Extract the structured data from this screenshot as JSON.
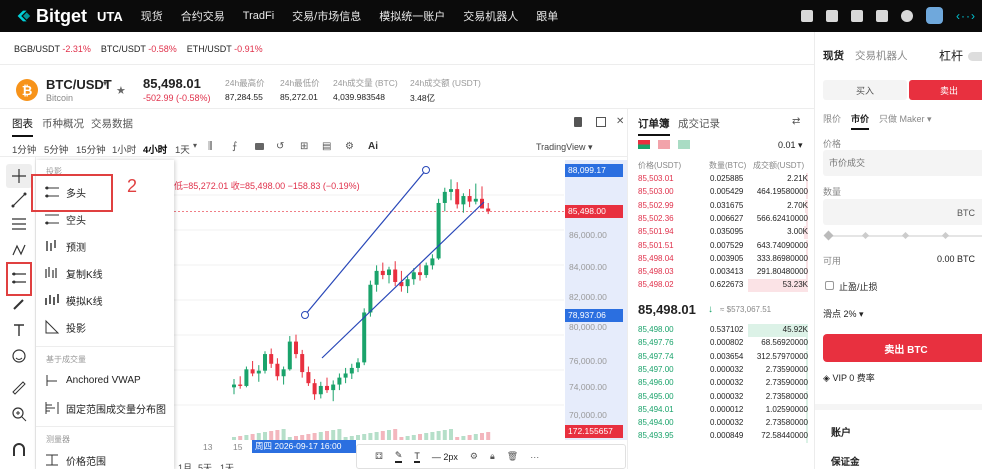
{
  "nav": {
    "brand": "Bitget",
    "account_type": "UTA",
    "items": [
      "现货",
      "合约交易",
      "TradFi",
      "交易/市场信息",
      "模拟统一账户",
      "交易机器人",
      "跟单"
    ]
  },
  "ticker_strip": [
    {
      "pair": "BGB/USDT",
      "change": "-2.31%"
    },
    {
      "pair": "BTC/USDT",
      "change": "-0.58%"
    },
    {
      "pair": "ETH/USDT",
      "change": "-0.91%"
    }
  ],
  "symbol": {
    "pair": "BTC/USDT",
    "name": "Bitcoin",
    "price": "85,498.01",
    "change": "-502.99 (-0.58%)",
    "stats": [
      {
        "label": "24h最高价",
        "value": "87,284.55"
      },
      {
        "label": "24h最低价",
        "value": "85,272.01"
      },
      {
        "label": "24h成交量 (BTC)",
        "value": "4,039.983548"
      },
      {
        "label": "24h成交额 (USDT)",
        "value": "3.48亿"
      }
    ]
  },
  "chart_tabs": [
    "图表",
    "币种概况",
    "交易数据"
  ],
  "timeframes": [
    "1分钟",
    "5分钟",
    "15分钟",
    "1小时",
    "4小时",
    "1天"
  ],
  "active_timeframe": "4小时",
  "tradingview_label": "TradingView",
  "ohlc_text": "低=85,272.01 收=85,498.00 −158.83 (−0.19%)",
  "popup": {
    "section1": "投影",
    "items1": [
      "多头",
      "空头",
      "预测",
      "复制K线",
      "模拟K线",
      "投影"
    ],
    "section2": "基于成交量",
    "items2": [
      "Anchored VWAP",
      "固定范围成交量分布图"
    ],
    "section3": "测量器",
    "items3": [
      "价格范围"
    ]
  },
  "annotations": {
    "label1": "1",
    "label2": "2"
  },
  "axis": {
    "labels": [
      "86,000.00",
      "84,000.00",
      "82,000.00",
      "80,000.00",
      "76,000.00",
      "74,000.00",
      "70,000.00"
    ],
    "top_box": "88,099.17",
    "price_box": "85,498.00",
    "low_box": "78,937.06",
    "vol_box": "172.155657"
  },
  "time_axis": {
    "labels": [
      "13",
      "15"
    ],
    "cursor": "周四 2026-09-17  16:00"
  },
  "bottom_bar": {
    "width_label": "2px"
  },
  "bottom_tf": [
    "1月",
    "5天",
    "1天"
  ],
  "orderbook": {
    "tabs": [
      "订单簿",
      "成交记录"
    ],
    "precision": "0.01",
    "headers": [
      "价格(USDT)",
      "数量(BTC)",
      "成交额(USDT)"
    ],
    "asks": [
      [
        "85,503.01",
        "0.025885",
        "2.21K"
      ],
      [
        "85,503.00",
        "0.005429",
        "464.19580000"
      ],
      [
        "85,502.99",
        "0.031675",
        "2.70K"
      ],
      [
        "85,502.36",
        "0.006627",
        "566.62410000"
      ],
      [
        "85,501.94",
        "0.035095",
        "3.00K"
      ],
      [
        "85,501.51",
        "0.007529",
        "643.74090000"
      ],
      [
        "85,498.04",
        "0.003905",
        "333.86980000"
      ],
      [
        "85,498.03",
        "0.003413",
        "291.80480000"
      ],
      [
        "85,498.02",
        "0.622673",
        "53.23K"
      ]
    ],
    "ask_depth": [
      0.04,
      0.005,
      0.05,
      0.01,
      0.06,
      0.012,
      0.006,
      0.006,
      1.0
    ],
    "mid_price": "85,498.01",
    "mid_sub": "≈ $573,067.51",
    "bids": [
      [
        "85,498.00",
        "0.537102",
        "45.92K"
      ],
      [
        "85,497.76",
        "0.000802",
        "68.56920000"
      ],
      [
        "85,497.74",
        "0.003654",
        "312.57970000"
      ],
      [
        "85,497.00",
        "0.000032",
        "2.73590000"
      ],
      [
        "85,496.00",
        "0.000032",
        "2.73590000"
      ],
      [
        "85,495.00",
        "0.000032",
        "2.73580000"
      ],
      [
        "85,494.01",
        "0.000012",
        "1.02590000"
      ],
      [
        "85,494.00",
        "0.000032",
        "2.73580000"
      ],
      [
        "85,493.95",
        "0.000849",
        "72.58440000"
      ]
    ],
    "bid_depth": [
      1.0,
      0.01,
      0.02,
      0.004,
      0.004,
      0.004,
      0.004,
      0.004,
      0.02
    ]
  },
  "trade_panel": {
    "tabs": [
      "现货",
      "交易机器人"
    ],
    "leverage": "杠杆",
    "buy": "买入",
    "sell": "卖出",
    "order_types": [
      "限价",
      "市价",
      "只做 Maker"
    ],
    "price_label": "价格",
    "price_placeholder": "市价成交",
    "qty_label": "数量",
    "qty_unit": "BTC",
    "available_label": "可用",
    "available_value": "0.00 BTC",
    "tpsl": "止盈/止损",
    "slippage": "滑点 2%",
    "sell_button": "卖出 BTC",
    "vip": "VIP 0 费率",
    "account": "账户",
    "margin": "保证金"
  },
  "chart_data": {
    "type": "candlestick",
    "y_range": [
      69000,
      89200
    ],
    "candles": [
      [
        72800,
        73400,
        72300,
        73000
      ],
      [
        73000,
        73600,
        72700,
        72900
      ],
      [
        72900,
        74300,
        72800,
        74100
      ],
      [
        74100,
        74700,
        73600,
        73800
      ],
      [
        73800,
        74400,
        73200,
        74000
      ],
      [
        74000,
        75400,
        73800,
        75200
      ],
      [
        75200,
        75600,
        74200,
        74500
      ],
      [
        74500,
        74900,
        73300,
        73600
      ],
      [
        73600,
        74300,
        73000,
        74100
      ],
      [
        74100,
        76500,
        74000,
        76100
      ],
      [
        76100,
        76600,
        74900,
        75200
      ],
      [
        75200,
        75500,
        73500,
        73900
      ],
      [
        73900,
        74300,
        72900,
        73100
      ],
      [
        73100,
        73400,
        71900,
        72300
      ],
      [
        72300,
        73200,
        72000,
        72900
      ],
      [
        72900,
        73500,
        72400,
        72600
      ],
      [
        72600,
        73300,
        71800,
        73000
      ],
      [
        73000,
        73800,
        72600,
        73500
      ],
      [
        73500,
        74200,
        73100,
        73800
      ],
      [
        73800,
        74500,
        73400,
        74200
      ],
      [
        74200,
        74900,
        73900,
        74600
      ],
      [
        74600,
        78500,
        74400,
        78200
      ],
      [
        78200,
        80500,
        77900,
        80200
      ],
      [
        80200,
        81600,
        79700,
        81200
      ],
      [
        81200,
        81800,
        80600,
        80900
      ],
      [
        80900,
        81500,
        80300,
        81300
      ],
      [
        81300,
        81900,
        80100,
        80400
      ],
      [
        80400,
        81200,
        79700,
        80100
      ],
      [
        80100,
        80800,
        79600,
        80600
      ],
      [
        80600,
        81400,
        80200,
        81100
      ],
      [
        81100,
        81700,
        80500,
        80900
      ],
      [
        80900,
        81800,
        80700,
        81600
      ],
      [
        81600,
        82400,
        81300,
        82100
      ],
      [
        82100,
        86400,
        82000,
        86100
      ],
      [
        86100,
        87200,
        85500,
        86900
      ],
      [
        86900,
        87800,
        86300,
        87100
      ],
      [
        87100,
        87600,
        85700,
        86000
      ],
      [
        86000,
        86800,
        85400,
        86600
      ],
      [
        86600,
        87100,
        85800,
        86200
      ],
      [
        86200,
        87500,
        86000,
        86400
      ],
      [
        86400,
        87300,
        85900,
        85700
      ],
      [
        85700,
        86100,
        85300,
        85498
      ]
    ]
  }
}
